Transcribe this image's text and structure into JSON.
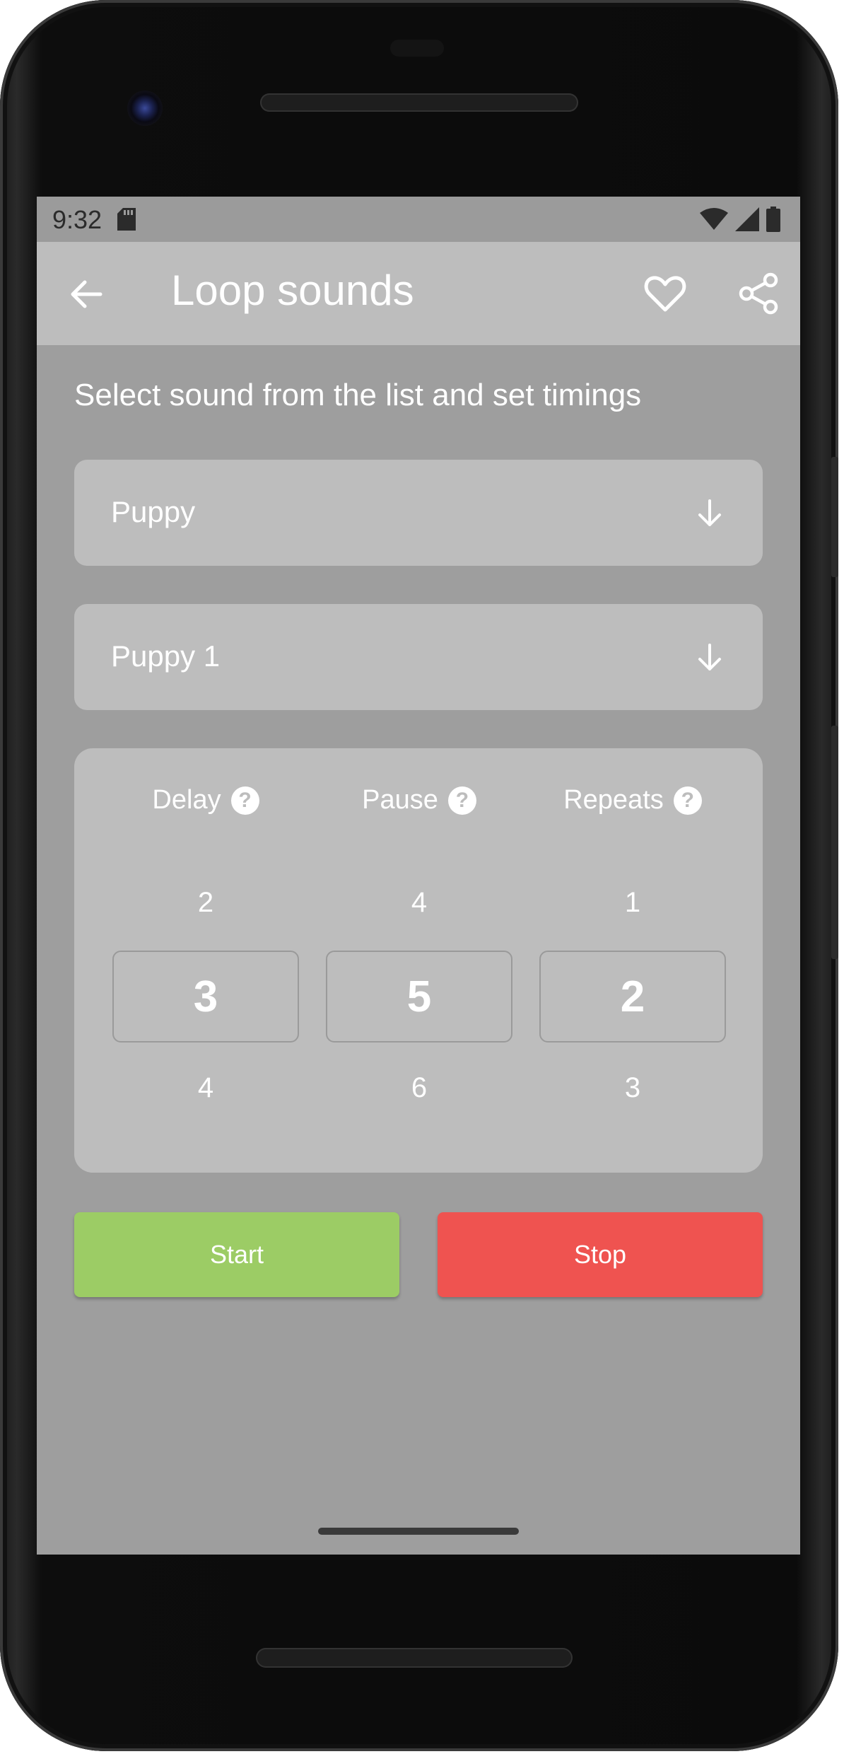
{
  "status_bar": {
    "time": "9:32"
  },
  "app_bar": {
    "title": "Loop sounds",
    "back_icon": "arrow-left-icon",
    "favorite_icon": "heart-outline-icon",
    "share_icon": "share-icon"
  },
  "instruction": "Select sound from the list and set timings",
  "category_dropdown": {
    "value": "Puppy",
    "icon": "arrow-down-icon"
  },
  "sound_dropdown": {
    "value": "Puppy 1",
    "icon": "arrow-down-icon"
  },
  "pickers": [
    {
      "label": "Delay",
      "above": "2",
      "selected": "3",
      "below": "4"
    },
    {
      "label": "Pause",
      "above": "4",
      "selected": "5",
      "below": "6"
    },
    {
      "label": "Repeats",
      "above": "1",
      "selected": "2",
      "below": "3"
    }
  ],
  "help_glyph": "?",
  "buttons": {
    "start": "Start",
    "stop": "Stop"
  },
  "colors": {
    "start": "#9ccc65",
    "stop": "#ef5350",
    "screen_background": "#9e9e9e",
    "surface": "#bdbdbd"
  }
}
